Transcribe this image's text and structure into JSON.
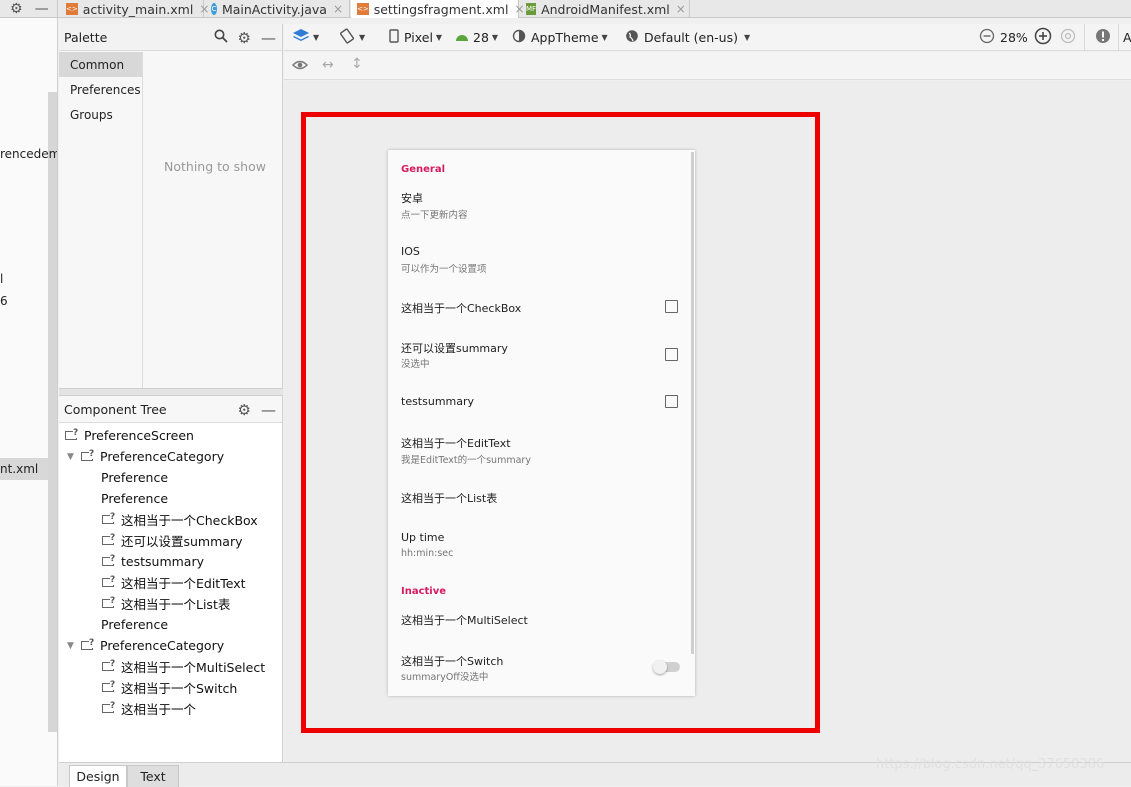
{
  "file_tabs": [
    {
      "label": "activity_main.xml",
      "icon": "xml-layout-icon"
    },
    {
      "label": "MainActivity.java",
      "icon": "java-class-icon"
    },
    {
      "label": "settingsfragment.xml",
      "icon": "xml-layout-icon"
    },
    {
      "label": "AndroidManifest.xml",
      "icon": "manifest-icon"
    }
  ],
  "left_strip": {
    "fragments": [
      "rencedem",
      "l",
      "6",
      "nt.xml"
    ]
  },
  "palette": {
    "title": "Palette",
    "categories": [
      "Common",
      "Preferences",
      "Groups"
    ],
    "empty_message": "Nothing to show"
  },
  "component_tree": {
    "title": "Component Tree",
    "nodes": [
      "PreferenceScreen",
      "PreferenceCategory",
      "Preference",
      "Preference",
      "这相当于一个CheckBox",
      "还可以设置summary",
      "testsummary",
      "这相当于一个EditText",
      "这相当于一个List表",
      "Preference",
      "PreferenceCategory",
      "这相当于一个MultiSelect",
      "这相当于一个Switch",
      "这相当于一个"
    ]
  },
  "toolbar": {
    "device": "Pixel",
    "api": "28",
    "theme": "AppTheme",
    "locale": "Default (en-us)",
    "zoom": "28%",
    "right_edge": "A"
  },
  "bottom_tabs": [
    "Design",
    "Text"
  ],
  "preview": {
    "category1": "General",
    "pref1_title": "安卓",
    "pref1_summary": "点一下更新内容",
    "pref2_title": "IOS",
    "pref2_summary": "可以作为一个设置项",
    "pref3_title": "这相当于一个CheckBox",
    "pref4_title": "还可以设置summary",
    "pref4_summary": "没选中",
    "pref5_title": "testsummary",
    "pref6_title": "这相当于一个EditText",
    "pref6_summary": "我是EditText的一个summary",
    "pref7_title": "这相当于一个List表",
    "pref8_title": "Up time",
    "pref8_summary": "hh:min:sec",
    "category2": "Inactive",
    "pref9_title": "这相当于一个MultiSelect",
    "pref10_title": "这相当于一个Switch",
    "pref10_summary": "summaryOff没选中"
  },
  "watermark": "https://blog.csdn.net/qq_37658386",
  "colors": {
    "highlight_box": "#ee0000",
    "category_accent": "#d81b60"
  }
}
